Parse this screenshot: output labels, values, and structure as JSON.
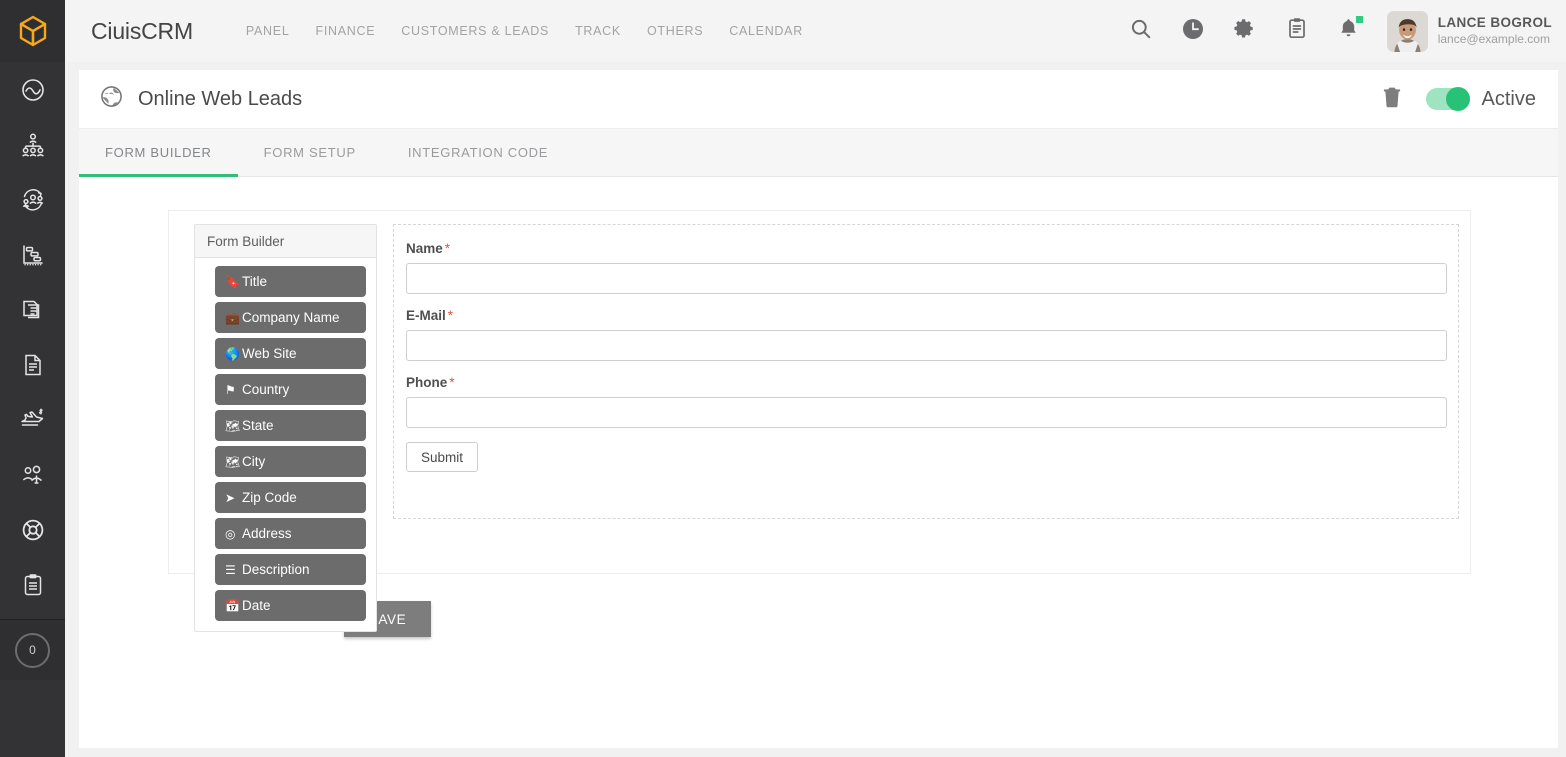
{
  "brand": {
    "logo_icon": "cube-logo-icon",
    "name": "CiuisCRM"
  },
  "nav": {
    "items": [
      {
        "label": "PANEL",
        "name": "nav-panel"
      },
      {
        "label": "FINANCE",
        "name": "nav-finance"
      },
      {
        "label": "CUSTOMERS & LEADS",
        "name": "nav-customers-leads"
      },
      {
        "label": "TRACK",
        "name": "nav-track"
      },
      {
        "label": "OTHERS",
        "name": "nav-others"
      },
      {
        "label": "CALENDAR",
        "name": "nav-calendar"
      }
    ]
  },
  "topbar_icons": [
    {
      "icon": "search-icon"
    },
    {
      "icon": "clock-icon"
    },
    {
      "icon": "gear-icon"
    },
    {
      "icon": "clipboard-notes-icon"
    },
    {
      "icon": "bell-icon",
      "badge": true
    }
  ],
  "user": {
    "name": "LANCE BOGROL",
    "email": "lance@example.com",
    "avatar": "user-photo-avatar"
  },
  "sidebar": {
    "items": [
      {
        "icon": "dashboard-chart-icon",
        "name": "sidebar-item-dashboard"
      },
      {
        "icon": "org-hierarchy-icon",
        "name": "sidebar-item-organization"
      },
      {
        "icon": "users-sync-icon",
        "name": "sidebar-item-customers"
      },
      {
        "icon": "gantt-chart-icon",
        "name": "sidebar-item-projects"
      },
      {
        "icon": "documents-stack-icon",
        "name": "sidebar-item-documents"
      },
      {
        "icon": "file-lines-icon",
        "name": "sidebar-item-files"
      },
      {
        "icon": "plane-dollar-icon",
        "name": "sidebar-item-expenses"
      },
      {
        "icon": "users-group-icon",
        "name": "sidebar-item-staff"
      },
      {
        "icon": "lifebuoy-icon",
        "name": "sidebar-item-support"
      },
      {
        "icon": "clipboard-icon",
        "name": "sidebar-item-tasks"
      }
    ],
    "badge_count": "0"
  },
  "page": {
    "icon": "globe-icon",
    "title": "Online Web Leads",
    "delete_icon": "trash-icon",
    "status_toggle": {
      "state": "on",
      "label": "Active"
    }
  },
  "tabs": [
    {
      "label": "FORM BUILDER",
      "active": true
    },
    {
      "label": "FORM SETUP",
      "active": false
    },
    {
      "label": "INTEGRATION CODE",
      "active": false
    }
  ],
  "palette": {
    "title": "Form Builder",
    "items": [
      {
        "label": "Title",
        "icon": "bookmark-icon",
        "glyph": "🔖"
      },
      {
        "label": "Company Name",
        "icon": "briefcase-icon",
        "glyph": "💼"
      },
      {
        "label": "Web Site",
        "icon": "globe-icon",
        "glyph": "⊕"
      },
      {
        "label": "Country",
        "icon": "flag-icon",
        "glyph": "⚑"
      },
      {
        "label": "State",
        "icon": "map-icon",
        "glyph": "🗺"
      },
      {
        "label": "City",
        "icon": "map-icon",
        "glyph": "🗺"
      },
      {
        "label": "Zip Code",
        "icon": "paper-plane-icon",
        "glyph": "➤"
      },
      {
        "label": "Address",
        "icon": "map-marker-icon",
        "glyph": "⌖"
      },
      {
        "label": "Description",
        "icon": "list-lines-icon",
        "glyph": "☰"
      },
      {
        "label": "Date",
        "icon": "calendar-icon",
        "glyph": "📅"
      }
    ]
  },
  "form_preview": {
    "fields": [
      {
        "label": "Name",
        "required": "*",
        "value": "",
        "placeholder": ""
      },
      {
        "label": "E-Mail",
        "required": "*",
        "value": "",
        "placeholder": ""
      },
      {
        "label": "Phone",
        "required": "*",
        "value": "",
        "placeholder": ""
      }
    ],
    "submit_label": "Submit"
  },
  "save_label": "SAVE",
  "colors": {
    "accent_green": "#2fbd79",
    "toggle_on": "#27c276",
    "logo_amber": "#f5a81c",
    "sidebar_bg": "#333335",
    "required_red": "#e8503a",
    "palette_item_bg": "#6c6c6c",
    "save_bg": "#7d7d7d"
  }
}
